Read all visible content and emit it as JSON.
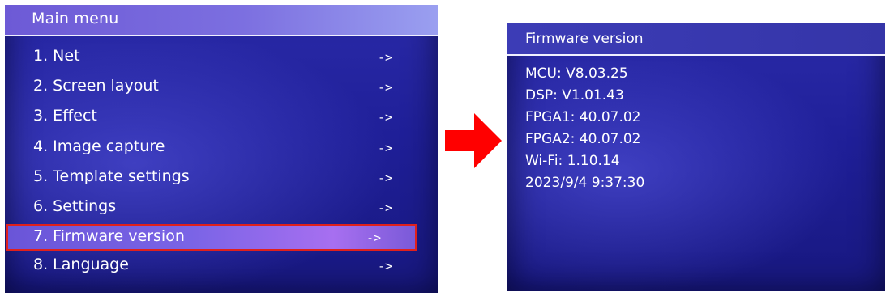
{
  "main_menu": {
    "title": "Main menu",
    "items": [
      {
        "label": "1. Net",
        "arrow": "->"
      },
      {
        "label": "2. Screen layout",
        "arrow": "->"
      },
      {
        "label": "3. Effect",
        "arrow": "->"
      },
      {
        "label": "4. Image capture",
        "arrow": "->"
      },
      {
        "label": "5. Template settings",
        "arrow": "->"
      },
      {
        "label": "6. Settings",
        "arrow": "->"
      },
      {
        "label": "7. Firmware version",
        "arrow": "->"
      },
      {
        "label": "8. Language",
        "arrow": "->"
      }
    ],
    "selected_item": "7. Firmware version"
  },
  "firmware_screen": {
    "title": "Firmware version",
    "lines": [
      "MCU: V8.03.25",
      "DSP:  V1.01.43",
      "FPGA1: 40.07.02",
      "FPGA2: 40.07.02",
      "Wi-Fi: 1.10.14",
      "2023/9/4 9:37:30"
    ]
  },
  "colors": {
    "screen_blue": "#1d1d90",
    "highlight_purple": "#7a64e6",
    "selection_border_red": "#e0201c",
    "transition_arrow_red": "#ff0000"
  },
  "icons": {
    "transition_arrow": "right-arrow-icon"
  }
}
